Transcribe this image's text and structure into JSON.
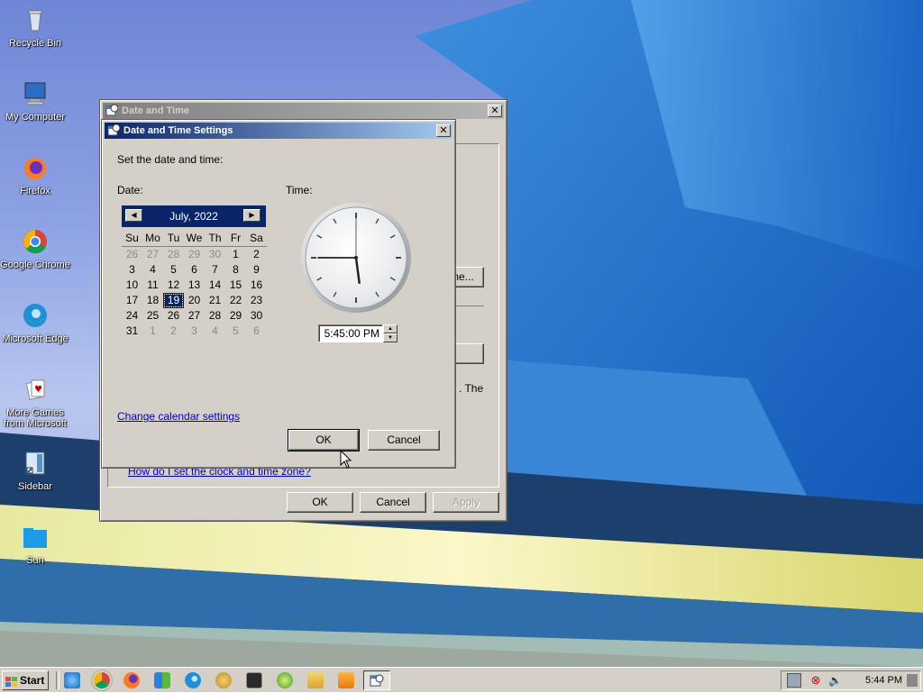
{
  "desktop": {
    "icons": [
      {
        "label": "Recycle Bin",
        "icon": "recycle-bin-icon"
      },
      {
        "label": "My Computer",
        "icon": "computer-icon"
      },
      {
        "label": "Firefox",
        "icon": "firefox-icon"
      },
      {
        "label": "Google Chrome",
        "icon": "chrome-icon"
      },
      {
        "label": "Microsoft Edge",
        "icon": "edge-icon"
      },
      {
        "label": "More Games from Microsoft",
        "icon": "games-icon"
      },
      {
        "label": "Sidebar",
        "icon": "sidebar-icon"
      },
      {
        "label": "Sun",
        "icon": "folder-icon"
      }
    ]
  },
  "outer_window": {
    "title": "Date and Time",
    "partial_button_text": "ne...",
    "partial_text": ". The",
    "help_link": "How do I set the clock and time zone?",
    "ok_label": "OK",
    "cancel_label": "Cancel",
    "apply_label": "Apply"
  },
  "dialog": {
    "title": "Date and Time Settings",
    "instruction": "Set the date and time:",
    "date_label": "Date:",
    "time_label": "Time:",
    "calendar": {
      "month_label": "July, 2022",
      "weekdays": [
        "Su",
        "Mo",
        "Tu",
        "We",
        "Th",
        "Fr",
        "Sa"
      ],
      "weeks": [
        [
          "26",
          "27",
          "28",
          "29",
          "30",
          "1",
          "2"
        ],
        [
          "3",
          "4",
          "5",
          "6",
          "7",
          "8",
          "9"
        ],
        [
          "10",
          "11",
          "12",
          "13",
          "14",
          "15",
          "16"
        ],
        [
          "17",
          "18",
          "19",
          "20",
          "21",
          "22",
          "23"
        ],
        [
          "24",
          "25",
          "26",
          "27",
          "28",
          "29",
          "30"
        ],
        [
          "31",
          "1",
          "2",
          "3",
          "4",
          "5",
          "6"
        ]
      ],
      "selected_day": "19"
    },
    "clock": {
      "hours": 5,
      "minutes": 45,
      "seconds": 0
    },
    "time_value": "5:45:00 PM",
    "change_calendar_link": "Change calendar settings",
    "ok_label": "OK",
    "cancel_label": "Cancel"
  },
  "taskbar": {
    "start_label": "Start",
    "quick_launch": [
      "ie-icon",
      "chrome-icon",
      "firefox-icon",
      "windows-icon",
      "edge-icon",
      "paint-icon",
      "terminal-icon",
      "xbox-icon",
      "explorer-icon",
      "media-icon",
      "date-time-icon"
    ],
    "clock": "5:44 PM"
  },
  "colors": {
    "titlebar_active": "#0a246a",
    "titlebar_inactive": "#808080",
    "face": "#d4d0c8",
    "link": "#0000cc"
  }
}
